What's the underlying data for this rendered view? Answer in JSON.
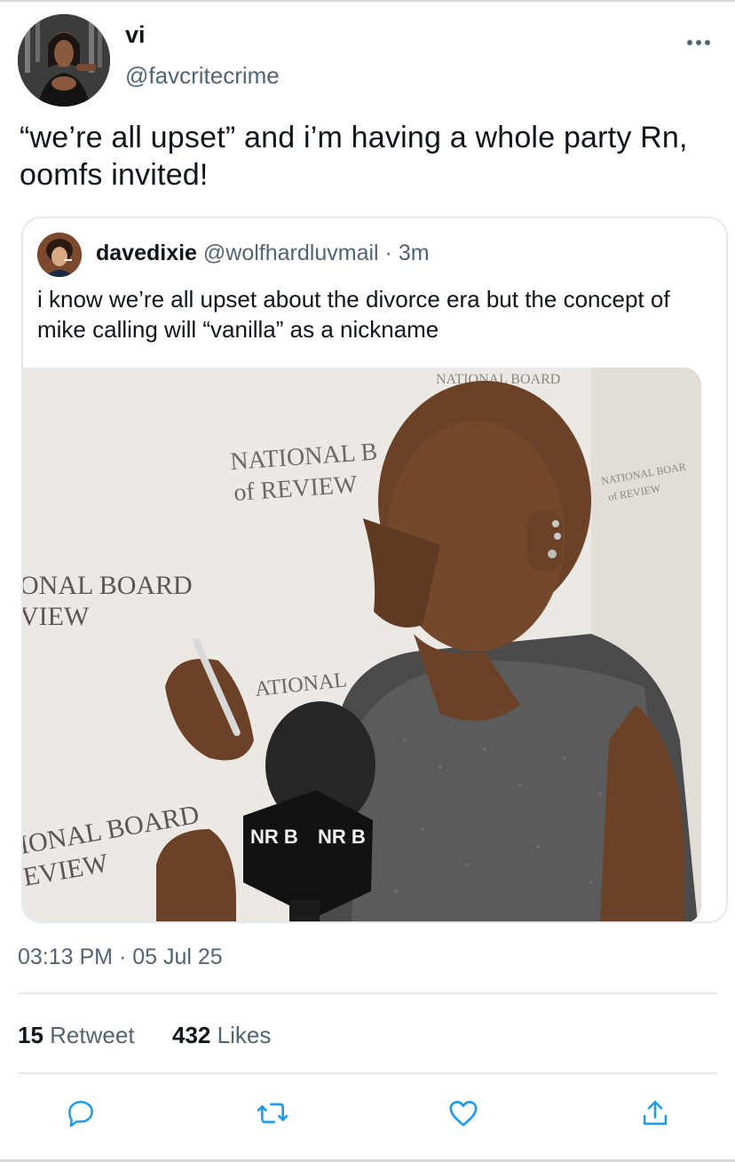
{
  "tweet": {
    "display_name": "vi",
    "handle": "@favcritecrime",
    "text": "“we’re all upset” and i’m having a whole party Rn, oomfs invited!",
    "timestamp": "03:13 PM · 05 Jul 25"
  },
  "quote": {
    "display_name": "davedixie",
    "handle": "@wolfhardluvmail",
    "separator": "·",
    "time": "3m",
    "text": "i know we’re all upset about the divorce era but the concept of mike calling will “vanilla” as a nickname",
    "media_backdrop_text": {
      "top_right": "NATIONAL BOARD",
      "center_line1": "NATIONAL B",
      "center_line2": "of REVIEW",
      "left_line1": "ONAL BOARD",
      "left_line2": "VIEW",
      "mid_line1": "ATIONAL",
      "bottom_left_line1": "IONAL BOARD",
      "bottom_left_line2": "EVIEW",
      "right_small1": "NATIONAL BOAR",
      "right_small2": "of REVIEW",
      "mic_flag_left": "NR B",
      "mic_flag_right": "NR B"
    }
  },
  "stats": {
    "retweets_count": "15",
    "retweets_label": "Retweet",
    "likes_count": "432",
    "likes_label": "Likes"
  },
  "icons": {
    "reply": "reply-icon",
    "retweet": "retweet-icon",
    "like": "heart-icon",
    "share": "share-icon",
    "more": "more-icon"
  },
  "colors": {
    "text_primary": "#0f1419",
    "text_secondary": "#536471",
    "action_blue": "#1d9bf0",
    "divider": "#e6e9eb"
  }
}
